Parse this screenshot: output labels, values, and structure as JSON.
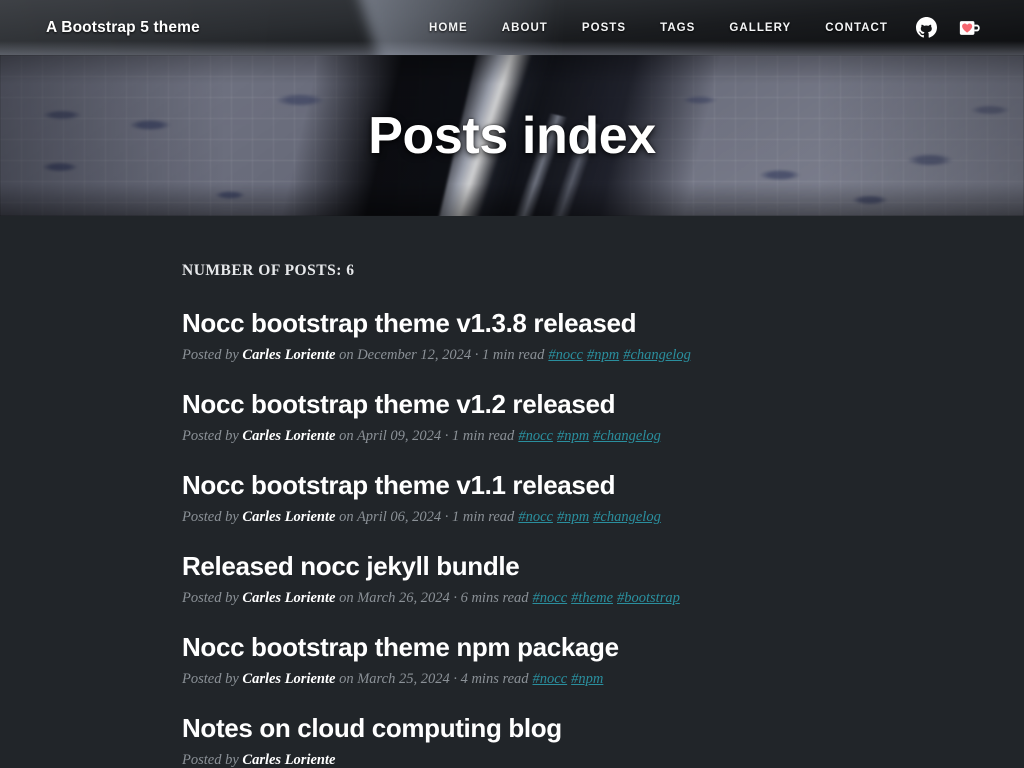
{
  "navbar": {
    "brand": "A Bootstrap 5 theme",
    "links": [
      {
        "label": "HOME",
        "name": "nav-link-home"
      },
      {
        "label": "ABOUT",
        "name": "nav-link-about"
      },
      {
        "label": "POSTS",
        "name": "nav-link-posts"
      },
      {
        "label": "TAGS",
        "name": "nav-link-tags"
      },
      {
        "label": "GALLERY",
        "name": "nav-link-gallery"
      },
      {
        "label": "CONTACT",
        "name": "nav-link-contact"
      }
    ],
    "icons": [
      {
        "name": "github-icon",
        "label": "GitHub"
      },
      {
        "name": "buy-me-a-coffee-icon",
        "label": "Buy me a coffee"
      }
    ]
  },
  "hero": {
    "title": "Posts index"
  },
  "main": {
    "post_count_label": "NUMBER OF POSTS: 6",
    "posted_by_label": "Posted by",
    "on_label": "on",
    "separator": "·",
    "posts": [
      {
        "title": "Nocc bootstrap theme v1.3.8 released",
        "author": "Carles Loriente",
        "date": "December 12, 2024",
        "read_time": "1 min read",
        "tags": [
          "#nocc",
          "#npm",
          "#changelog"
        ]
      },
      {
        "title": "Nocc bootstrap theme v1.2 released",
        "author": "Carles Loriente",
        "date": "April 09, 2024",
        "read_time": "1 min read",
        "tags": [
          "#nocc",
          "#npm",
          "#changelog"
        ]
      },
      {
        "title": "Nocc bootstrap theme v1.1 released",
        "author": "Carles Loriente",
        "date": "April 06, 2024",
        "read_time": "1 min read",
        "tags": [
          "#nocc",
          "#npm",
          "#changelog"
        ]
      },
      {
        "title": "Released nocc jekyll bundle",
        "author": "Carles Loriente",
        "date": "March 26, 2024",
        "read_time": "6 mins read",
        "tags": [
          "#nocc",
          "#theme",
          "#bootstrap"
        ]
      },
      {
        "title": "Nocc bootstrap theme npm package",
        "author": "Carles Loriente",
        "date": "March 25, 2024",
        "read_time": "4 mins read",
        "tags": [
          "#nocc",
          "#npm"
        ]
      },
      {
        "title": "Notes on cloud computing blog",
        "author": "Carles Loriente",
        "date": "",
        "read_time": "",
        "tags": []
      }
    ]
  },
  "colors": {
    "page_background": "#212529",
    "navbar_background": "#1a1c1f",
    "text_primary": "#ffffff",
    "text_muted": "#8b9197",
    "tag_link": "#2a8f9e",
    "heart_red": "#f6656f"
  }
}
